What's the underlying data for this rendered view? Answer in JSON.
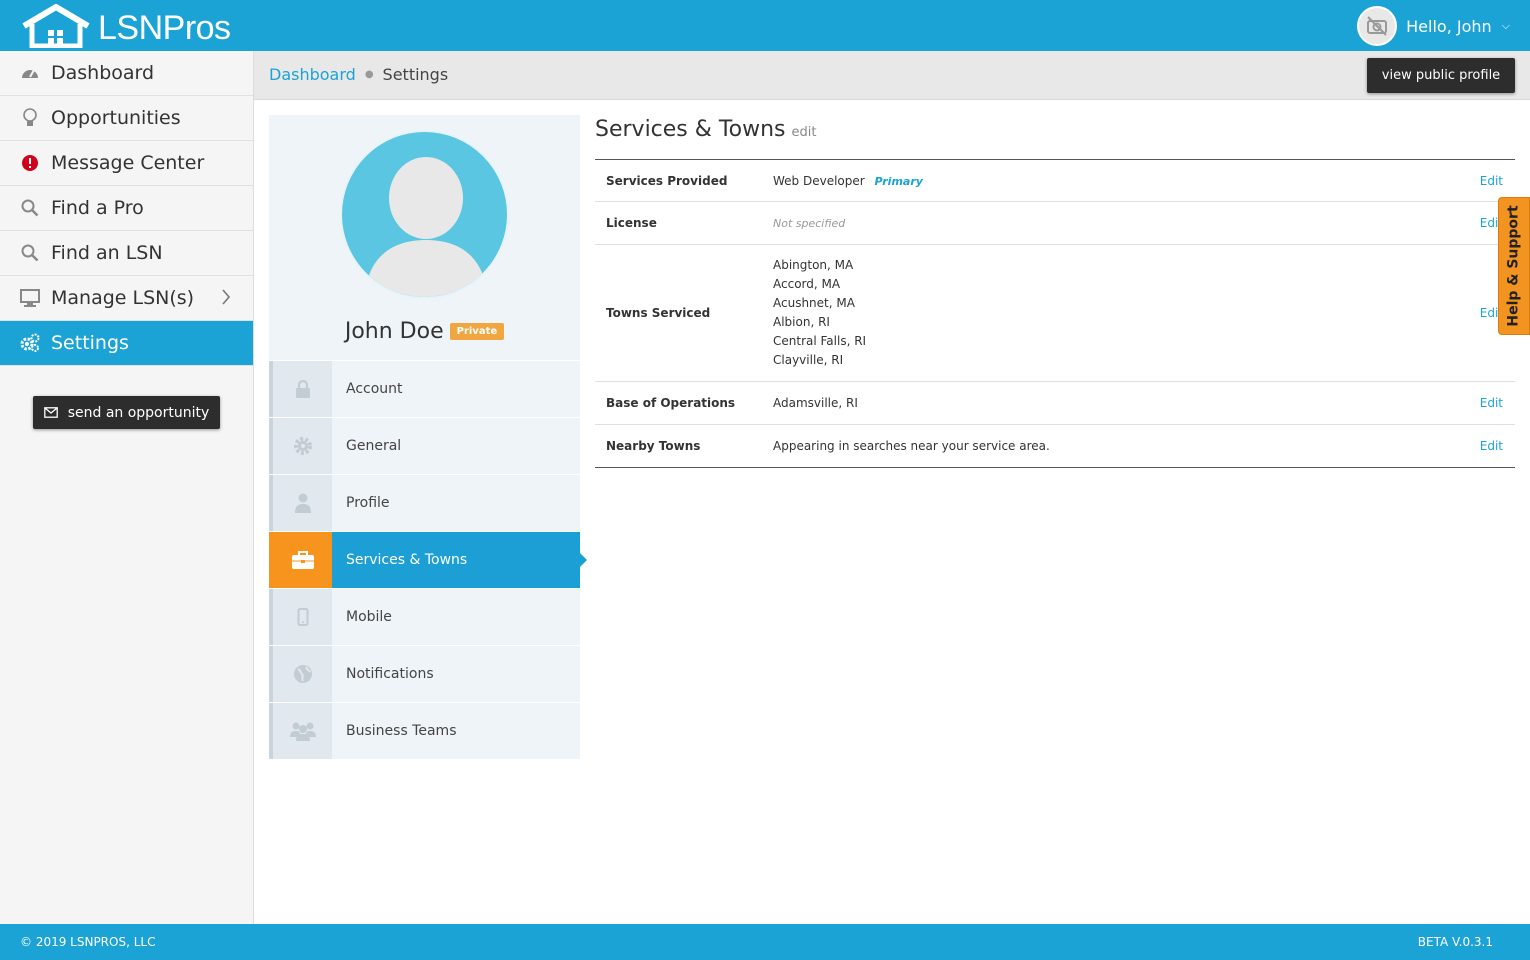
{
  "brand": {
    "name": "LSNPros"
  },
  "user_menu": {
    "greeting": "Hello, John"
  },
  "sidebar": {
    "items": [
      {
        "label": "Dashboard",
        "icon": "dashboard-icon"
      },
      {
        "label": "Opportunities",
        "icon": "lightbulb-icon"
      },
      {
        "label": "Message Center",
        "icon": "alert-icon"
      },
      {
        "label": "Find a Pro",
        "icon": "search-icon"
      },
      {
        "label": "Find an LSN",
        "icon": "search-icon"
      },
      {
        "label": "Manage LSN(s)",
        "icon": "monitor-icon"
      },
      {
        "label": "Settings",
        "icon": "gears-icon",
        "active": true
      }
    ],
    "send_button": "send an opportunity"
  },
  "breadcrumb": {
    "home": "Dashboard",
    "current": "Settings"
  },
  "view_public_profile": "view public profile",
  "profile": {
    "name": "John Doe",
    "badge": "Private"
  },
  "settings_nav": [
    {
      "label": "Account",
      "icon": "lock-icon"
    },
    {
      "label": "General",
      "icon": "gear-icon"
    },
    {
      "label": "Profile",
      "icon": "user-icon"
    },
    {
      "label": "Services & Towns",
      "icon": "briefcase-icon",
      "active": true
    },
    {
      "label": "Mobile",
      "icon": "mobile-icon"
    },
    {
      "label": "Notifications",
      "icon": "globe-icon"
    },
    {
      "label": "Business Teams",
      "icon": "team-icon"
    }
  ],
  "main": {
    "title": "Services & Towns",
    "title_edit": "edit",
    "rows": {
      "services": {
        "label": "Services Provided",
        "value": "Web Developer",
        "tag": "Primary",
        "edit": "Edit"
      },
      "license": {
        "label": "License",
        "value": "Not specified",
        "edit": "Edit"
      },
      "towns": {
        "label": "Towns Serviced",
        "values": [
          "Abington, MA",
          "Accord, MA",
          "Acushnet, MA",
          "Albion, RI",
          "Central Falls, RI",
          "Clayville, RI"
        ],
        "edit": "Edit"
      },
      "base": {
        "label": "Base of Operations",
        "value": "Adamsville, RI",
        "edit": "Edit"
      },
      "nearby": {
        "label": "Nearby Towns",
        "value": "Appearing in searches near your service area.",
        "edit": "Edit"
      }
    }
  },
  "help_tab": "Help & Support",
  "footer": {
    "copyright": "© 2019 LSNPROS, LLC",
    "version": "BETA V.0.3.1"
  },
  "colors": {
    "primary": "#1ba3d6",
    "accent": "#f7941d",
    "dark_button": "#2d2d2d",
    "badge": "#f0a742"
  }
}
